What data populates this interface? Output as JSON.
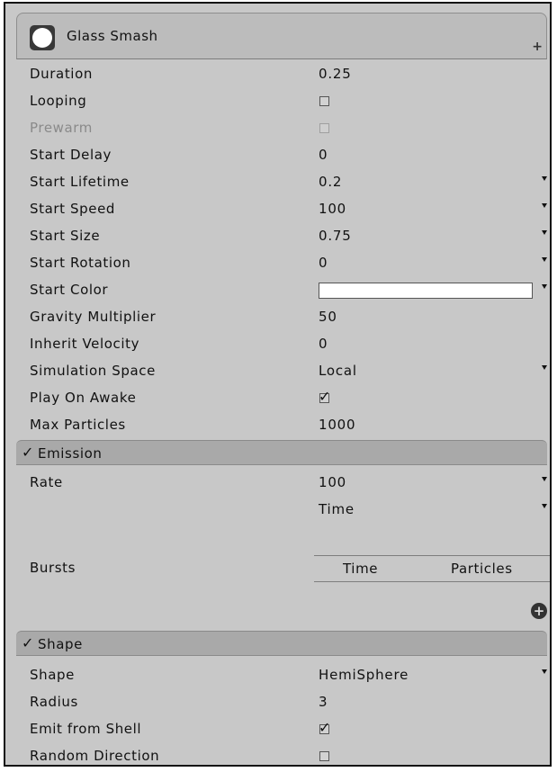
{
  "header": {
    "title": "Glass Smash",
    "icon": "particle-system-icon",
    "add_icon": "plus-icon"
  },
  "main": {
    "duration": {
      "label": "Duration",
      "value": "0.25"
    },
    "looping": {
      "label": "Looping",
      "checked": false
    },
    "prewarm": {
      "label": "Prewarm",
      "checked": false,
      "disabled": true
    },
    "start_delay": {
      "label": "Start Delay",
      "value": "0"
    },
    "start_lifetime": {
      "label": "Start Lifetime",
      "value": "0.2"
    },
    "start_speed": {
      "label": "Start Speed",
      "value": "100"
    },
    "start_size": {
      "label": "Start Size",
      "value": "0.75"
    },
    "start_rotation": {
      "label": "Start Rotation",
      "value": "0"
    },
    "start_color": {
      "label": "Start Color",
      "color": "#ffffff"
    },
    "gravity_multiplier": {
      "label": "Gravity Multiplier",
      "value": "50"
    },
    "inherit_velocity": {
      "label": "Inherit Velocity",
      "value": "0"
    },
    "simulation_space": {
      "label": "Simulation Space",
      "value": "Local"
    },
    "play_on_awake": {
      "label": "Play On Awake",
      "checked": true
    },
    "max_particles": {
      "label": "Max Particles",
      "value": "1000"
    }
  },
  "emission": {
    "title": "Emission",
    "enabled": true,
    "rate": {
      "label": "Rate",
      "value": "100",
      "mode": "Time"
    },
    "bursts": {
      "label": "Bursts",
      "col_time": "Time",
      "col_particles": "Particles"
    }
  },
  "shape": {
    "title": "Shape",
    "enabled": true,
    "shape": {
      "label": "Shape",
      "value": "HemiSphere"
    },
    "radius": {
      "label": "Radius",
      "value": "3"
    },
    "emit_from_shell": {
      "label": "Emit from Shell",
      "checked": true
    },
    "random_direction": {
      "label": "Random Direction",
      "checked": false
    }
  },
  "glyphs": {
    "check": "✓",
    "add": "+"
  },
  "colors": {
    "panel_bg": "#c8c8c8",
    "module_header_bg": "#a9a9a9",
    "text": "#111111",
    "disabled_text": "#8a8a8a"
  }
}
